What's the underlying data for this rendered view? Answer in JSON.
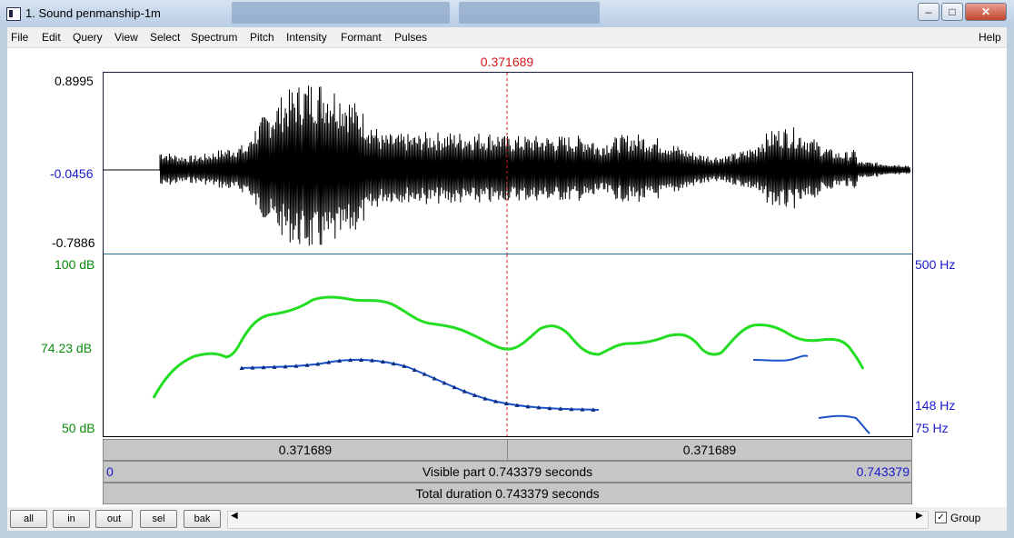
{
  "window": {
    "title": "1. Sound penmanship-1m"
  },
  "menu": {
    "items": [
      "File",
      "Edit",
      "Query",
      "View",
      "Select",
      "Spectrum",
      "Pitch",
      "Intensity",
      "Formant",
      "Pulses"
    ],
    "help": "Help"
  },
  "cursor": {
    "time": "0.371689"
  },
  "waveform": {
    "max": "0.8995",
    "mid": "-0.0456",
    "min": "-0.7886"
  },
  "spectrogram": {
    "db_top": "100 dB",
    "db_mid": "74.23 dB",
    "db_bottom": "50 dB",
    "hz_top": "500 Hz",
    "hz_mid": "148 Hz",
    "hz_bottom": "75 Hz",
    "colors": {
      "intensity": "#22dd22",
      "pitch": "#1a50c8"
    }
  },
  "time_bars": {
    "left_segment": "0.371689",
    "right_segment": "0.371689",
    "visible_start": "0",
    "visible_label": "Visible part 0.743379 seconds",
    "visible_end": "0.743379",
    "total_label": "Total duration 0.743379 seconds"
  },
  "bottom": {
    "buttons": [
      "all",
      "in",
      "out",
      "sel",
      "bak"
    ],
    "group_label": "Group",
    "group_checked": true
  }
}
